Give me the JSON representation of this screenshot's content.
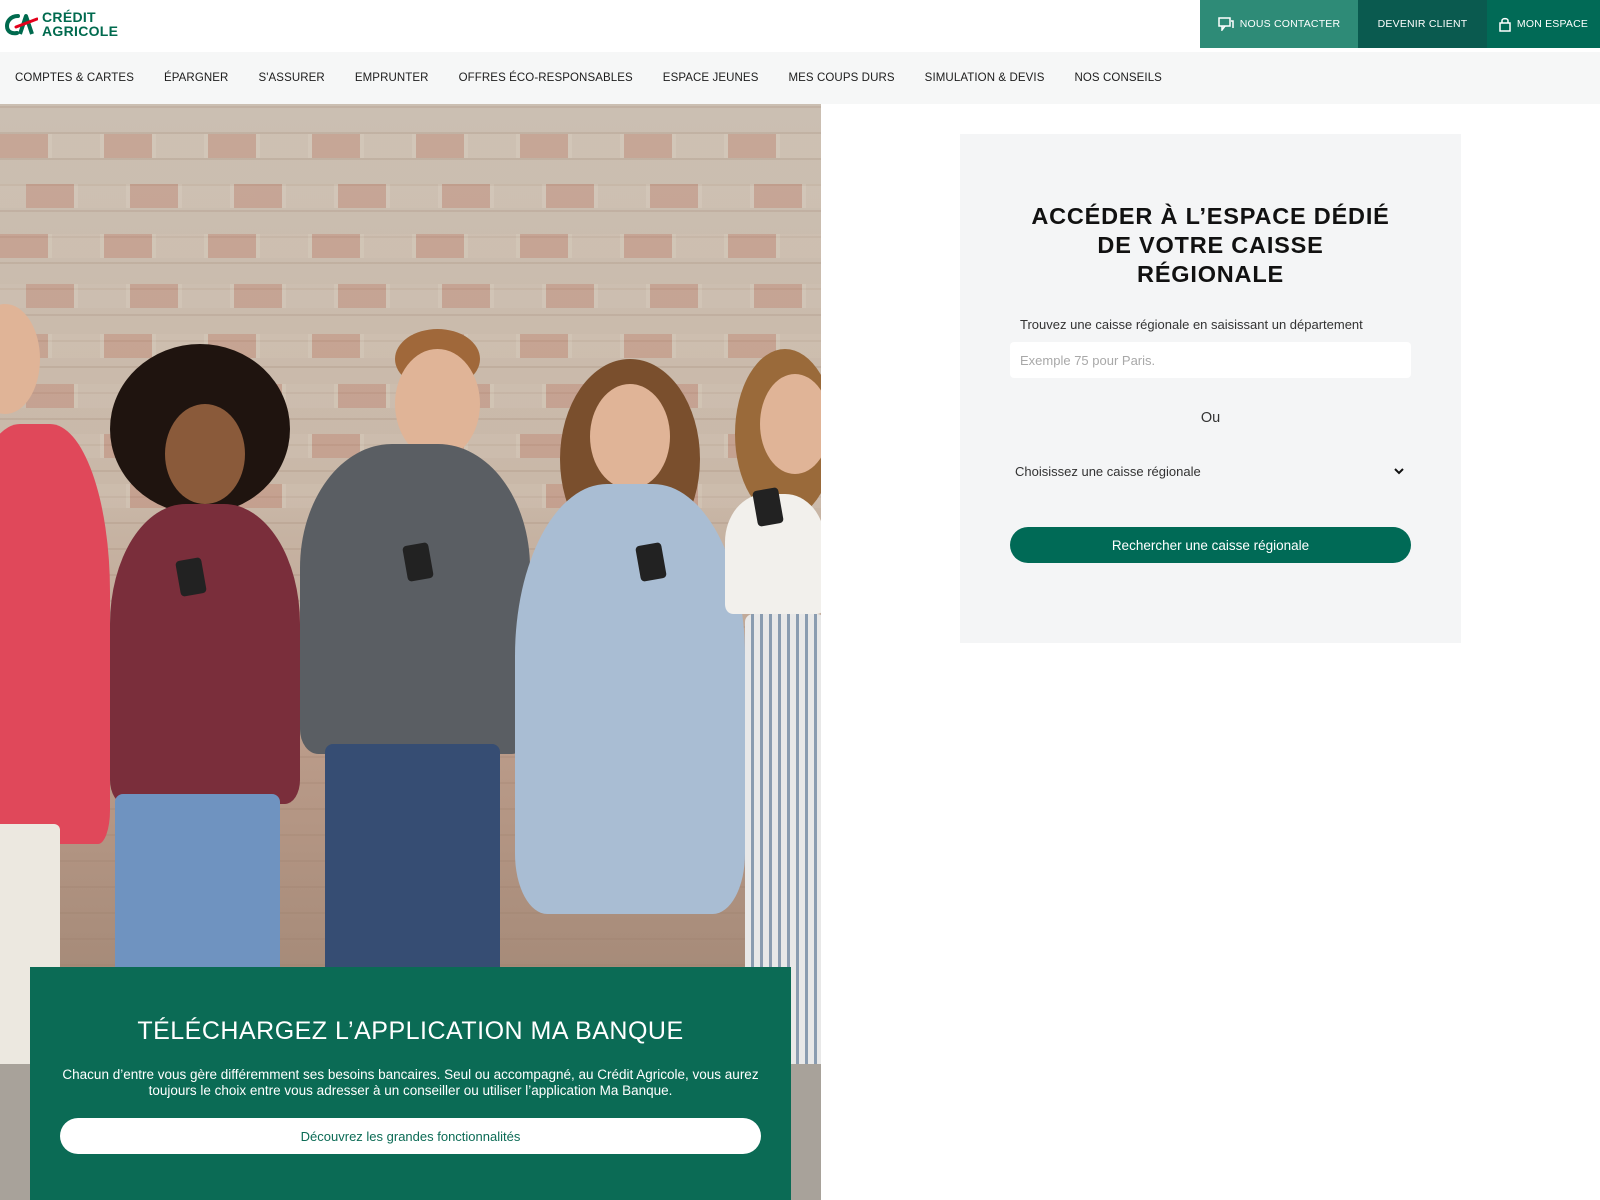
{
  "header": {
    "logo_line1": "CRÉDIT",
    "logo_line2": "AGRICOLE",
    "contact_label": "NOUS CONTACTER",
    "client_label": "DEVENIR CLIENT",
    "espace_label": "MON ESPACE",
    "contact_icon": "chat-icon",
    "espace_icon": "lock-icon"
  },
  "nav": {
    "items": [
      "COMPTES & CARTES",
      "ÉPARGNER",
      "S'ASSURER",
      "EMPRUNTER",
      "OFFRES ÉCO-RESPONSABLES",
      "ESPACE JEUNES",
      "MES COUPS DURS",
      "SIMULATION & DEVIS",
      "NOS CONSEILS"
    ]
  },
  "promo": {
    "title": "TÉLÉCHARGEZ L’APPLICATION MA BANQUE",
    "text": "Chacun d’entre vous gère différemment ses besoins bancaires. Seul ou accompagné, au Crédit Agricole, vous aurez toujours le choix entre vous adresser à un conseiller ou utiliser l’application Ma Banque.",
    "button_label": "Découvrez les grandes fonctionnalités"
  },
  "panel": {
    "title_line1": "ACCÉDER À L’ESPACE DÉDIÉ",
    "title_line2": "DE VOTRE CAISSE",
    "title_line3": "RÉGIONALE",
    "hint": "Trouvez une caisse régionale en saisissant un département",
    "input_placeholder": "Exemple 75 pour Paris.",
    "input_value": "",
    "or_text": "Ou",
    "select_label": "Choisissez une caisse régionale",
    "search_button": "Rechercher une caisse régionale"
  },
  "colors": {
    "brand_green": "#006a56",
    "contact_bg": "#2e8b77",
    "client_bg": "#0a5a4f",
    "promo_bg": "#0b6b55",
    "panel_bg": "#f4f5f6",
    "logo_red": "#e3001b"
  }
}
